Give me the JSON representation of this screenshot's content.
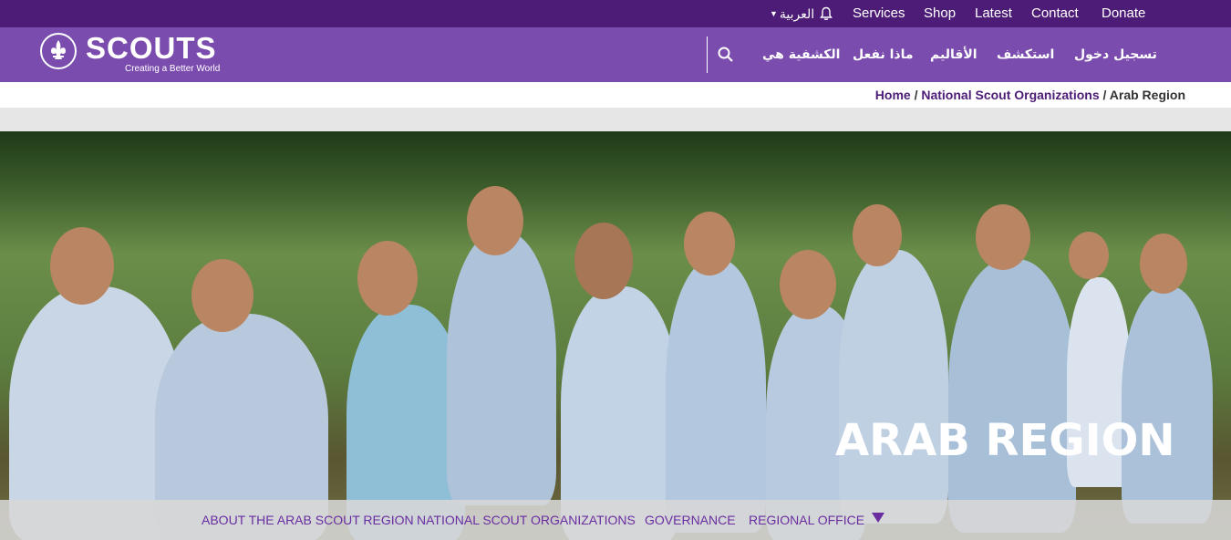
{
  "topbar": {
    "language": "العربية",
    "links": [
      "Services",
      "Shop",
      "Latest",
      "Contact",
      "Donate"
    ]
  },
  "logo": {
    "wordmark": "SCOUTS",
    "tagline": "Creating a Better World"
  },
  "nav": {
    "items": [
      "تسجيل دخول",
      "استكشف",
      "الأقاليم",
      "ماذا نفعل",
      "الكشفية هي"
    ]
  },
  "breadcrumb": {
    "home": "Home",
    "sep": " / ",
    "parent": "National Scout Organizations",
    "current": "Arab Region"
  },
  "hero": {
    "title": "ARAB REGION"
  },
  "subnav": {
    "items": [
      "ABOUT THE ARAB SCOUT REGION",
      "NATIONAL SCOUT ORGANIZATIONS",
      "GOVERNANCE",
      "REGIONAL OFFICE"
    ]
  },
  "colors": {
    "top_bar": "#4d1c77",
    "main_nav": "#7a4cae",
    "accent": "#6a2da0"
  },
  "icons": [
    "bell-icon",
    "search-icon",
    "scouts-emblem-icon",
    "chevron-down-icon"
  ]
}
